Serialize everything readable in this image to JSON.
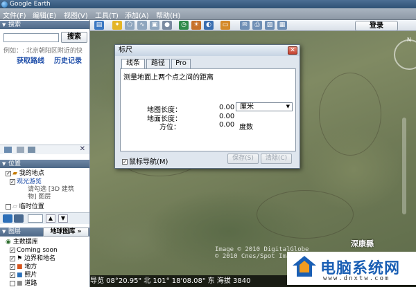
{
  "window": {
    "title": "Google Earth"
  },
  "menu": [
    "文件(F)",
    "编辑(E)",
    "视图(V)",
    "工具(T)",
    "添加(A)",
    "帮助(H)"
  ],
  "toolbar": {
    "login": "登录"
  },
  "search": {
    "header": "搜索",
    "button": "搜索",
    "hint": "例如：: 北京朝阳区附近的快",
    "directions": "获取路线",
    "history": "历史记录"
  },
  "places": {
    "header": "位置",
    "my_places": "我的地点",
    "tour": "观光游览",
    "tour_note1": "请勾选 [3D 建筑",
    "tour_note2": "物] 图层",
    "temp": "临时位置"
  },
  "layers": {
    "header": "图层",
    "gallery": "地球图库 »",
    "primary": "主数据库",
    "items": [
      "Coming soon",
      "边界和地名",
      "地方",
      "照片",
      "道路"
    ]
  },
  "dialog": {
    "title": "标尺",
    "tabs": [
      "线条",
      "路径",
      "Pro"
    ],
    "description": "测量地面上两个点之间的距离",
    "map_length_label": "地图长度：",
    "map_length_value": "0.00",
    "unit": "厘米",
    "ground_length_label": "地面长度：",
    "ground_length_value": "0.00",
    "heading_label": "方位：",
    "heading_value": "0.00",
    "heading_unit": "度数",
    "nav_label": "鼠标导航(M)",
    "save": "保存(S)",
    "clear": "清除(C)"
  },
  "map": {
    "copyright1": "Image © 2010 DigitalGlobe",
    "copyright2": "© 2010 Cnes/Spot Image",
    "place_label": "深康縣"
  },
  "status": {
    "text": "导览     08°20.95\"  北 101° 18'08.08\" 东 海拔   3840"
  },
  "watermark": {
    "big": "电脑系统网",
    "small": "www.dnxtw.com"
  }
}
